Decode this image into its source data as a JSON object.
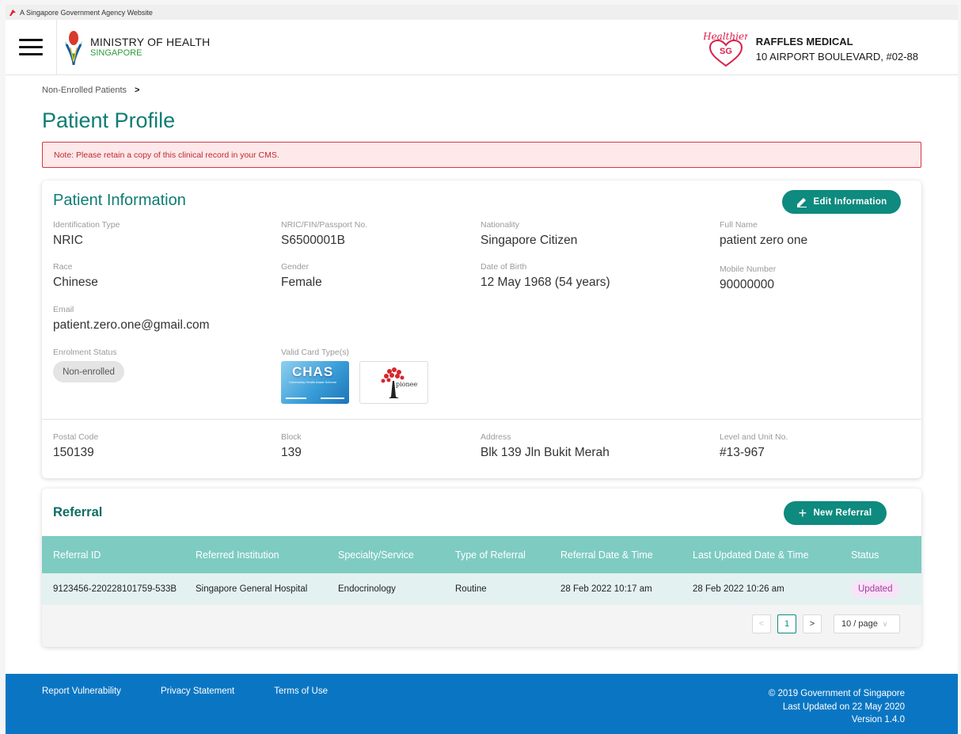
{
  "gov_bar": {
    "text": "A Singapore Government Agency Website"
  },
  "header": {
    "ministry_title": "MINISTRY OF HEALTH",
    "ministry_sub": "SINGAPORE",
    "healthier_logo_text": "Healthier",
    "healthier_logo_sg": "SG",
    "clinic_name": "RAFFLES MEDICAL",
    "clinic_address": "10 AIRPORT BOULEVARD, #02-88"
  },
  "breadcrumb": {
    "item": "Non-Enrolled Patients",
    "separator": ">"
  },
  "page_title": "Patient Profile",
  "note": "Note: Please retain a copy of this clinical record in your CMS.",
  "patient_info": {
    "title": "Patient Information",
    "edit_label": "Edit Information",
    "id_type_label": "Identification Type",
    "id_type": "NRIC",
    "nric_label": "NRIC/FIN/Passport No.",
    "nric": "S6500001B",
    "nationality_label": "Nationality",
    "nationality": "Singapore Citizen",
    "fullname_label": "Full Name",
    "fullname": "patient zero one",
    "race_label": "Race",
    "race": "Chinese",
    "gender_label": "Gender",
    "gender": "Female",
    "dob_label": "Date of Birth",
    "dob": "12 May 1968 (54 years)",
    "mobile_label": "Mobile Number",
    "mobile": "90000000",
    "email_label": "Email",
    "email": "patient.zero.one@gmail.com",
    "enrolment_label": "Enrolment Status",
    "enrolment": "Non-enrolled",
    "cards_label": "Valid Card Type(s)",
    "chas_text": "CHAS",
    "chas_sub": "Community Health Assist Scheme",
    "pioneer_text": "pioneer",
    "postal_label": "Postal Code",
    "postal": "150139",
    "block_label": "Block",
    "block": "139",
    "address_label": "Address",
    "address": "Blk 139 Jln Bukit Merah",
    "unit_label": "Level and Unit No.",
    "unit": "#13-967"
  },
  "referral": {
    "title": "Referral",
    "new_label": "New Referral",
    "columns": [
      "Referral ID",
      "Referred Institution",
      "Specialty/Service",
      "Type of Referral",
      "Referral Date & Time",
      "Last Updated Date & Time",
      "Status"
    ],
    "rows": [
      [
        "9123456-220228101759-533B",
        "Singapore General Hospital",
        "Endocrinology",
        "Routine",
        "28 Feb 2022 10:17 am",
        "28 Feb 2022 10:26 am",
        "Updated"
      ]
    ],
    "pagination": {
      "prev": "<",
      "current": "1",
      "next": ">",
      "page_size": "10 / page"
    }
  },
  "footer": {
    "links": [
      "Report Vulnerability",
      "Privacy Statement",
      "Terms of Use"
    ],
    "copyright": "© 2019 Government of Singapore",
    "last_updated": "Last Updated on 22 May 2020",
    "version": "Version 1.4.0"
  },
  "colors": {
    "accent": "#0e8a7e",
    "title_teal": "#0e7d72",
    "table_header": "#7ecbc2",
    "footer": "#0a76c3",
    "note_border": "#d9363e"
  }
}
